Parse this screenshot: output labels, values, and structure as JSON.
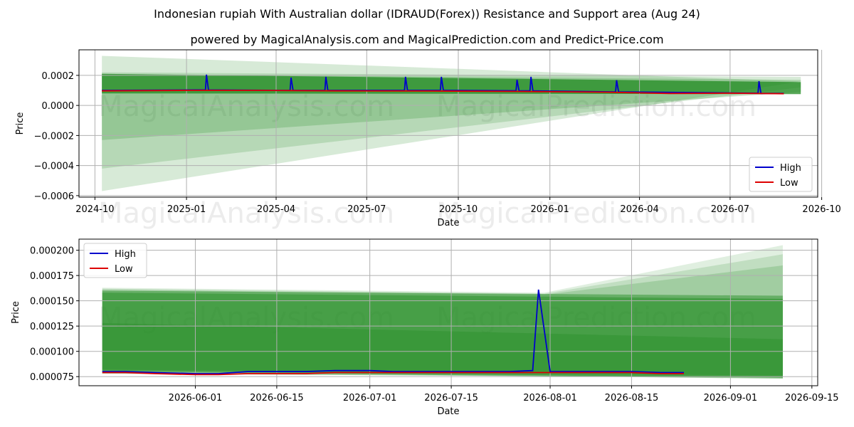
{
  "title": "Indonesian rupiah With Australian dollar (IDRAUD(Forex)) Resistance and Support area (Aug 24)",
  "subtitle": "powered by MagicalAnalysis.com and MagicalPrediction.com and Predict-Price.com",
  "watermarks": [
    "MagicalAnalysis.com",
    "MagicalPrediction.com"
  ],
  "colors": {
    "high": "#0000cc",
    "low": "#dd0000",
    "band": "#228b22",
    "grid": "#b0b0b0"
  },
  "chart_data": [
    {
      "type": "line",
      "xlabel": "Date",
      "ylabel": "Price",
      "xlim": [
        "2024-09-15",
        "2026-09-27"
      ],
      "ylim": [
        -0.00061,
        0.00037
      ],
      "xticks": [
        {
          "date": "2024-10-01",
          "label": "2024-10"
        },
        {
          "date": "2025-01-01",
          "label": "2025-01"
        },
        {
          "date": "2025-04-01",
          "label": "2025-04"
        },
        {
          "date": "2025-07-01",
          "label": "2025-07"
        },
        {
          "date": "2025-10-01",
          "label": "2025-10"
        },
        {
          "date": "2026-01-01",
          "label": "2026-01"
        },
        {
          "date": "2026-04-01",
          "label": "2026-04"
        },
        {
          "date": "2026-07-01",
          "label": "2026-07"
        },
        {
          "date": "2026-10-01",
          "label": "2026-10"
        }
      ],
      "yticks": [
        {
          "value": 0.0002,
          "label": "0.0002"
        },
        {
          "value": 0.0,
          "label": "0.0000"
        },
        {
          "value": -0.0002,
          "label": "−0.0002"
        },
        {
          "value": -0.0004,
          "label": "−0.0004"
        },
        {
          "value": -0.0006,
          "label": "−0.0006"
        }
      ],
      "grid": true,
      "legend": "bottom-right",
      "bands": [
        {
          "x0": "2024-10-08",
          "x1": "2026-09-10",
          "top0": 0.00033,
          "top1": 0.00016,
          "bot0": -0.00057,
          "bot1": 0.00016,
          "opacity": 0.18
        },
        {
          "x0": "2024-10-08",
          "x1": "2026-09-10",
          "top0": 0.00022,
          "top1": 0.00019,
          "bot0": -0.00042,
          "bot1": 0.00012,
          "opacity": 0.18
        },
        {
          "x0": "2024-10-08",
          "x1": "2026-09-10",
          "top0": 0.00021,
          "top1": 0.00017,
          "bot0": -0.00023,
          "bot1": 9e-05,
          "opacity": 0.22
        },
        {
          "x0": "2024-10-08",
          "x1": "2026-09-10",
          "top0": 0.00021,
          "top1": 0.000155,
          "bot0": 8e-05,
          "bot1": 7.5e-05,
          "opacity": 0.75
        }
      ],
      "series": [
        {
          "name": "High",
          "points": [
            [
              "2024-10-08",
              0.0001
            ],
            [
              "2025-01-10",
              0.000103
            ],
            [
              "2025-01-20",
              0.000103
            ],
            [
              "2025-01-21",
              0.000205
            ],
            [
              "2025-01-23",
              0.000103
            ],
            [
              "2025-04-15",
              0.0001
            ],
            [
              "2025-04-16",
              0.000185
            ],
            [
              "2025-04-18",
              0.0001
            ],
            [
              "2025-05-20",
              0.0001
            ],
            [
              "2025-05-21",
              0.00019
            ],
            [
              "2025-05-23",
              0.0001
            ],
            [
              "2025-08-08",
              0.0001
            ],
            [
              "2025-08-09",
              0.00019
            ],
            [
              "2025-08-11",
              0.0001
            ],
            [
              "2025-09-13",
              0.0001
            ],
            [
              "2025-09-14",
              0.00019
            ],
            [
              "2025-09-16",
              0.0001
            ],
            [
              "2025-11-28",
              9.8e-05
            ],
            [
              "2025-11-29",
              0.00017
            ],
            [
              "2025-12-01",
              9.8e-05
            ],
            [
              "2025-12-12",
              9.7e-05
            ],
            [
              "2025-12-13",
              0.00019
            ],
            [
              "2025-12-15",
              9.7e-05
            ],
            [
              "2026-03-08",
              9e-05
            ],
            [
              "2026-03-09",
              0.000168
            ],
            [
              "2026-03-11",
              9e-05
            ],
            [
              "2026-07-29",
              8.1e-05
            ],
            [
              "2026-07-30",
              0.000161
            ],
            [
              "2026-08-01",
              8e-05
            ],
            [
              "2026-08-24",
              8e-05
            ]
          ]
        },
        {
          "name": "Low",
          "points": [
            [
              "2024-10-08",
              9.7e-05
            ],
            [
              "2025-01-01",
              0.0001
            ],
            [
              "2025-03-15",
              0.0001
            ],
            [
              "2025-06-01",
              9.7e-05
            ],
            [
              "2025-09-01",
              9.6e-05
            ],
            [
              "2025-12-01",
              9.3e-05
            ],
            [
              "2026-03-01",
              8.8e-05
            ],
            [
              "2026-05-01",
              8e-05
            ],
            [
              "2026-07-01",
              8.1e-05
            ],
            [
              "2026-08-24",
              7.8e-05
            ]
          ]
        }
      ]
    },
    {
      "type": "line",
      "xlabel": "Date",
      "ylabel": "Price",
      "xlim": [
        "2026-05-12",
        "2026-09-16"
      ],
      "ylim": [
        6.6e-05,
        0.000211
      ],
      "xticks": [
        {
          "date": "2026-06-01",
          "label": "2026-06-01"
        },
        {
          "date": "2026-06-15",
          "label": "2026-06-15"
        },
        {
          "date": "2026-07-01",
          "label": "2026-07-01"
        },
        {
          "date": "2026-07-15",
          "label": "2026-07-15"
        },
        {
          "date": "2026-08-01",
          "label": "2026-08-01"
        },
        {
          "date": "2026-08-15",
          "label": "2026-08-15"
        },
        {
          "date": "2026-09-01",
          "label": "2026-09-01"
        },
        {
          "date": "2026-09-15",
          "label": "2026-09-15"
        }
      ],
      "yticks": [
        {
          "value": 0.0002,
          "label": "0.000200"
        },
        {
          "value": 0.000175,
          "label": "0.000175"
        },
        {
          "value": 0.00015,
          "label": "0.000150"
        },
        {
          "value": 0.000125,
          "label": "0.000125"
        },
        {
          "value": 0.0001,
          "label": "0.000100"
        },
        {
          "value": 7.5e-05,
          "label": "0.000075"
        }
      ],
      "grid": true,
      "legend": "top-left",
      "bands": [
        {
          "x0": "2026-05-16",
          "x1": "2026-09-10",
          "top0": 0.000163,
          "top1": 0.000205,
          "bot0": 7.8e-05,
          "bot1": 7.4e-05,
          "opacity": 0.14,
          "kink": [
            "2026-07-31",
            0.000158
          ]
        },
        {
          "x0": "2026-05-16",
          "x1": "2026-09-10",
          "top0": 0.000162,
          "top1": 0.000196,
          "bot0": 7.8e-05,
          "bot1": 7.4e-05,
          "opacity": 0.16,
          "kink": [
            "2026-07-31",
            0.000157
          ]
        },
        {
          "x0": "2026-05-16",
          "x1": "2026-09-10",
          "top0": 0.000161,
          "top1": 0.000185,
          "bot0": 7.8e-05,
          "bot1": 7.4e-05,
          "opacity": 0.2,
          "kink": [
            "2026-07-31",
            0.000156
          ]
        },
        {
          "x0": "2026-05-16",
          "x1": "2026-09-10",
          "top0": 0.00016,
          "top1": 0.000155,
          "bot0": 8e-05,
          "bot1": 7.3e-05,
          "opacity": 0.45
        },
        {
          "x0": "2026-05-16",
          "x1": "2026-09-10",
          "top0": 0.000158,
          "top1": 0.000152,
          "bot0": 8.1e-05,
          "bot1": 7.4e-05,
          "opacity": 0.45
        },
        {
          "x0": "2026-05-16",
          "x1": "2026-09-10",
          "top0": 0.000128,
          "top1": 0.000112,
          "bot0": 8.2e-05,
          "bot1": 7.6e-05,
          "opacity": 0.35
        }
      ],
      "series": [
        {
          "name": "High",
          "points": [
            [
              "2026-05-16",
              8e-05
            ],
            [
              "2026-05-20",
              8e-05
            ],
            [
              "2026-05-25",
              7.9e-05
            ],
            [
              "2026-06-01",
              7.8e-05
            ],
            [
              "2026-06-05",
              7.8e-05
            ],
            [
              "2026-06-10",
              8e-05
            ],
            [
              "2026-06-15",
              8e-05
            ],
            [
              "2026-06-20",
              8e-05
            ],
            [
              "2026-06-25",
              8.1e-05
            ],
            [
              "2026-07-01",
              8.1e-05
            ],
            [
              "2026-07-05",
              8e-05
            ],
            [
              "2026-07-10",
              8e-05
            ],
            [
              "2026-07-15",
              8e-05
            ],
            [
              "2026-07-20",
              8e-05
            ],
            [
              "2026-07-25",
              8e-05
            ],
            [
              "2026-07-29",
              8.1e-05
            ],
            [
              "2026-07-30",
              0.000161
            ],
            [
              "2026-08-01",
              8e-05
            ],
            [
              "2026-08-05",
              8e-05
            ],
            [
              "2026-08-10",
              8e-05
            ],
            [
              "2026-08-15",
              8e-05
            ],
            [
              "2026-08-20",
              7.9e-05
            ],
            [
              "2026-08-24",
              7.9e-05
            ]
          ]
        },
        {
          "name": "Low",
          "points": [
            [
              "2026-05-16",
              7.9e-05
            ],
            [
              "2026-05-20",
              7.9e-05
            ],
            [
              "2026-05-25",
              7.8e-05
            ],
            [
              "2026-06-01",
              7.7e-05
            ],
            [
              "2026-06-05",
              7.7e-05
            ],
            [
              "2026-06-10",
              7.8e-05
            ],
            [
              "2026-06-15",
              7.8e-05
            ],
            [
              "2026-06-20",
              7.8e-05
            ],
            [
              "2026-06-25",
              7.9e-05
            ],
            [
              "2026-07-01",
              7.9e-05
            ],
            [
              "2026-07-05",
              7.9e-05
            ],
            [
              "2026-07-10",
              7.9e-05
            ],
            [
              "2026-07-15",
              7.9e-05
            ],
            [
              "2026-07-20",
              7.9e-05
            ],
            [
              "2026-07-25",
              7.9e-05
            ],
            [
              "2026-08-01",
              7.9e-05
            ],
            [
              "2026-08-05",
              7.9e-05
            ],
            [
              "2026-08-10",
              7.9e-05
            ],
            [
              "2026-08-15",
              7.9e-05
            ],
            [
              "2026-08-20",
              7.8e-05
            ],
            [
              "2026-08-24",
              7.8e-05
            ]
          ]
        }
      ]
    }
  ]
}
